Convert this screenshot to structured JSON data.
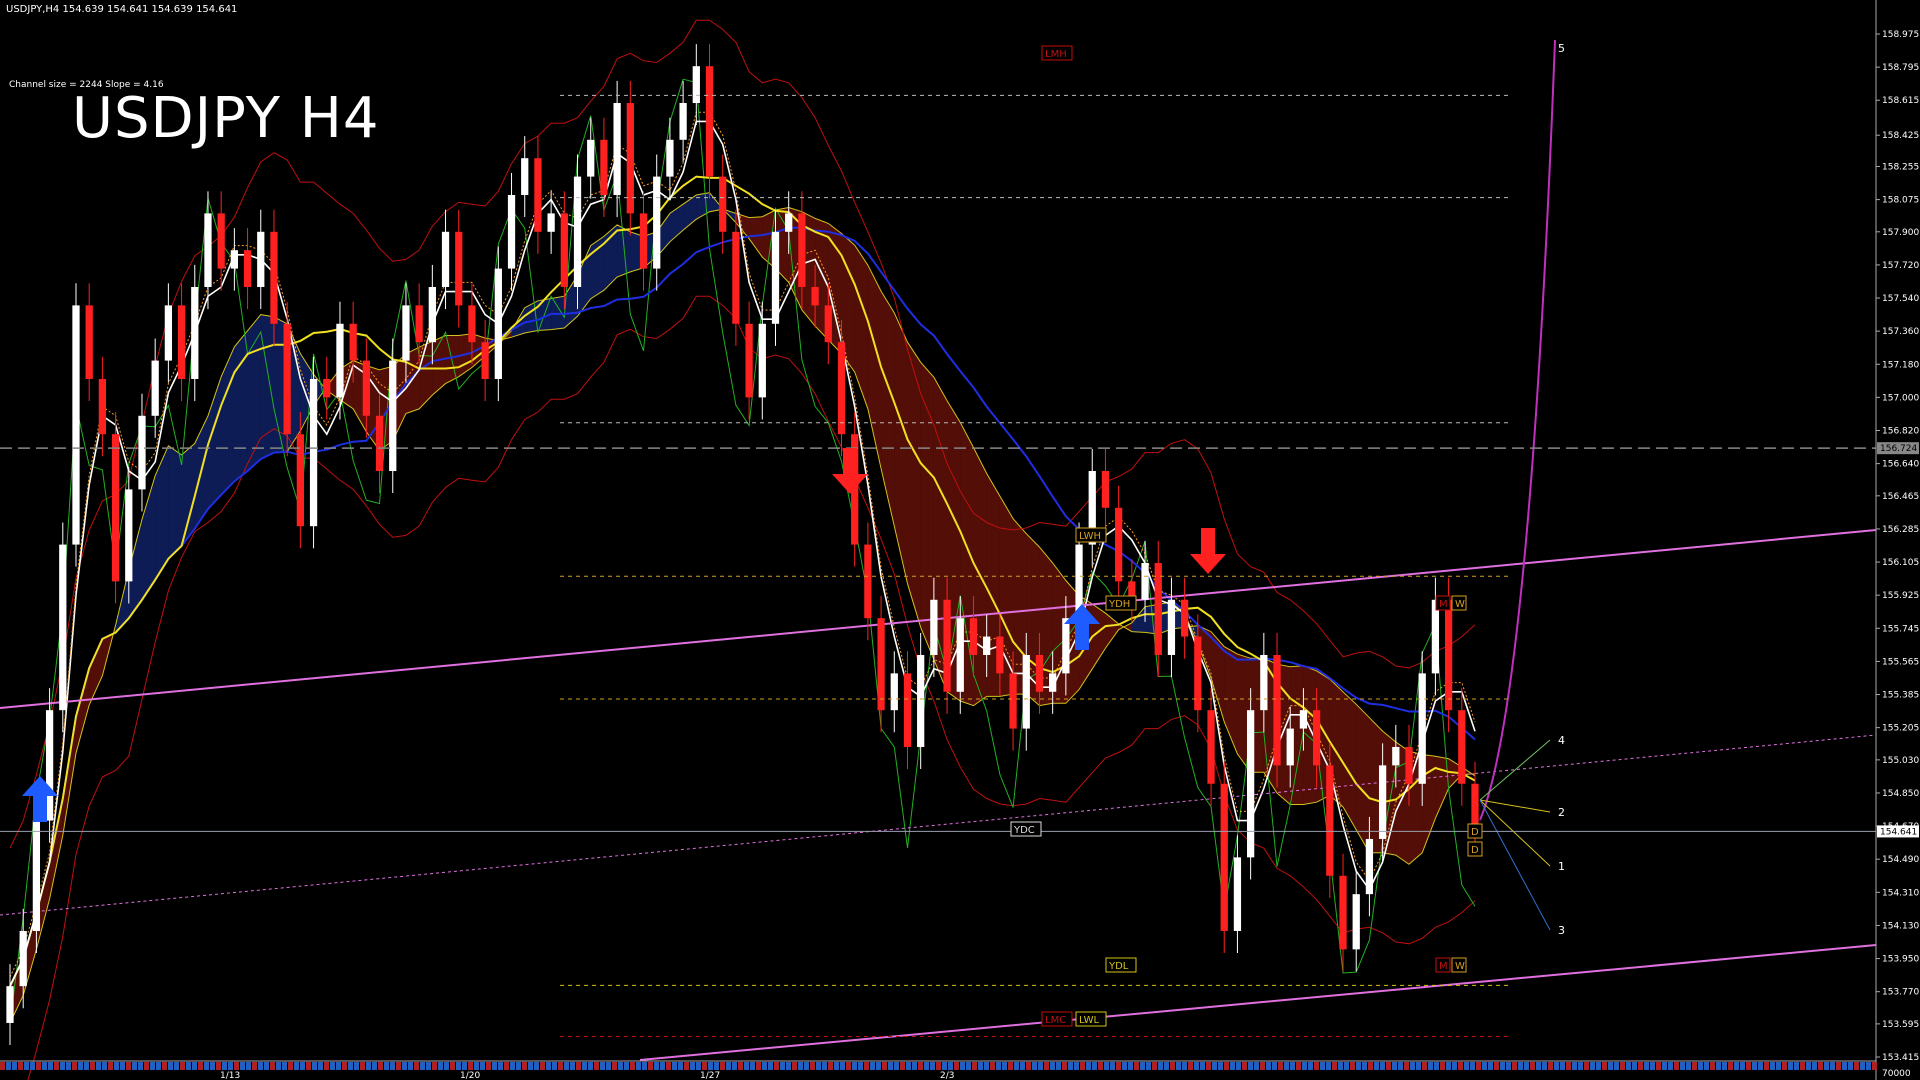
{
  "header": {
    "symbol_line": "USDJPY,H4  154.639 154.641 154.639 154.641",
    "channel_info": "Channel size = 2244 Slope = 4.16",
    "title": "USDJPY H4"
  },
  "chart_data": {
    "type": "candlestick",
    "symbol": "USDJPY",
    "timeframe": "H4",
    "current_price": "154.641",
    "level_line": "156.724",
    "y_ticks": [
      "158.975",
      "158.795",
      "158.615",
      "158.425",
      "158.255",
      "158.075",
      "157.900",
      "157.720",
      "157.540",
      "157.360",
      "157.180",
      "157.000",
      "156.820",
      "156.640",
      "156.465",
      "156.285",
      "156.105",
      "155.925",
      "155.745",
      "155.565",
      "155.385",
      "155.205",
      "155.030",
      "154.850",
      "154.670",
      "154.490",
      "154.310",
      "154.130",
      "153.950",
      "153.770",
      "153.595",
      "153.415"
    ],
    "volume_label": "70000",
    "x_ticks": [
      "1/13",
      "1/20",
      "1/27",
      "2/3"
    ],
    "ylim": [
      153.415,
      158.975
    ],
    "level_labels": [
      "LMH",
      "LWH",
      "YDH",
      "YDC",
      "YDL",
      "LWL",
      "LMC",
      "M",
      "W",
      "D",
      "D",
      "M",
      "W"
    ],
    "projection_labels": [
      "5",
      "4",
      "2",
      "1",
      "3"
    ],
    "arrows": [
      {
        "dir": "up",
        "color": "#1e5cff"
      },
      {
        "dir": "down",
        "color": "#ff2020"
      },
      {
        "dir": "down",
        "color": "#ff2020"
      },
      {
        "dir": "up",
        "color": "#1e5cff"
      }
    ],
    "close_path": [
      153.8,
      154.1,
      154.7,
      155.3,
      156.2,
      157.5,
      157.1,
      156.8,
      156.0,
      156.5,
      156.9,
      157.2,
      157.5,
      157.1,
      157.6,
      158.0,
      157.7,
      157.8,
      157.6,
      157.9,
      157.4,
      156.8,
      156.3,
      157.1,
      157.0,
      157.4,
      157.2,
      156.9,
      156.6,
      157.2,
      157.5,
      157.3,
      157.6,
      157.9,
      157.5,
      157.3,
      157.1,
      157.7,
      158.1,
      158.3,
      157.9,
      158.0,
      157.6,
      158.2,
      158.4,
      158.1,
      158.6,
      158.0,
      157.7,
      158.2,
      158.4,
      158.6,
      158.8,
      158.2,
      157.9,
      157.4,
      157.0,
      157.4,
      157.9,
      158.0,
      157.6,
      157.5,
      157.3,
      156.8,
      156.2,
      155.8,
      155.3,
      155.5,
      155.1,
      155.6,
      155.9,
      155.4,
      155.8,
      155.6,
      155.7,
      155.5,
      155.2,
      155.6,
      155.4,
      155.5,
      155.8,
      156.2,
      156.6,
      156.4,
      156.0,
      155.9,
      156.1,
      155.6,
      155.9,
      155.7,
      155.3,
      154.9,
      154.1,
      154.5,
      155.3,
      155.6,
      155.0,
      155.2,
      155.3,
      155.0,
      154.4,
      154.0,
      154.3,
      154.6,
      155.0,
      155.1,
      154.9,
      155.5,
      155.9,
      155.3,
      154.9,
      154.64
    ]
  }
}
